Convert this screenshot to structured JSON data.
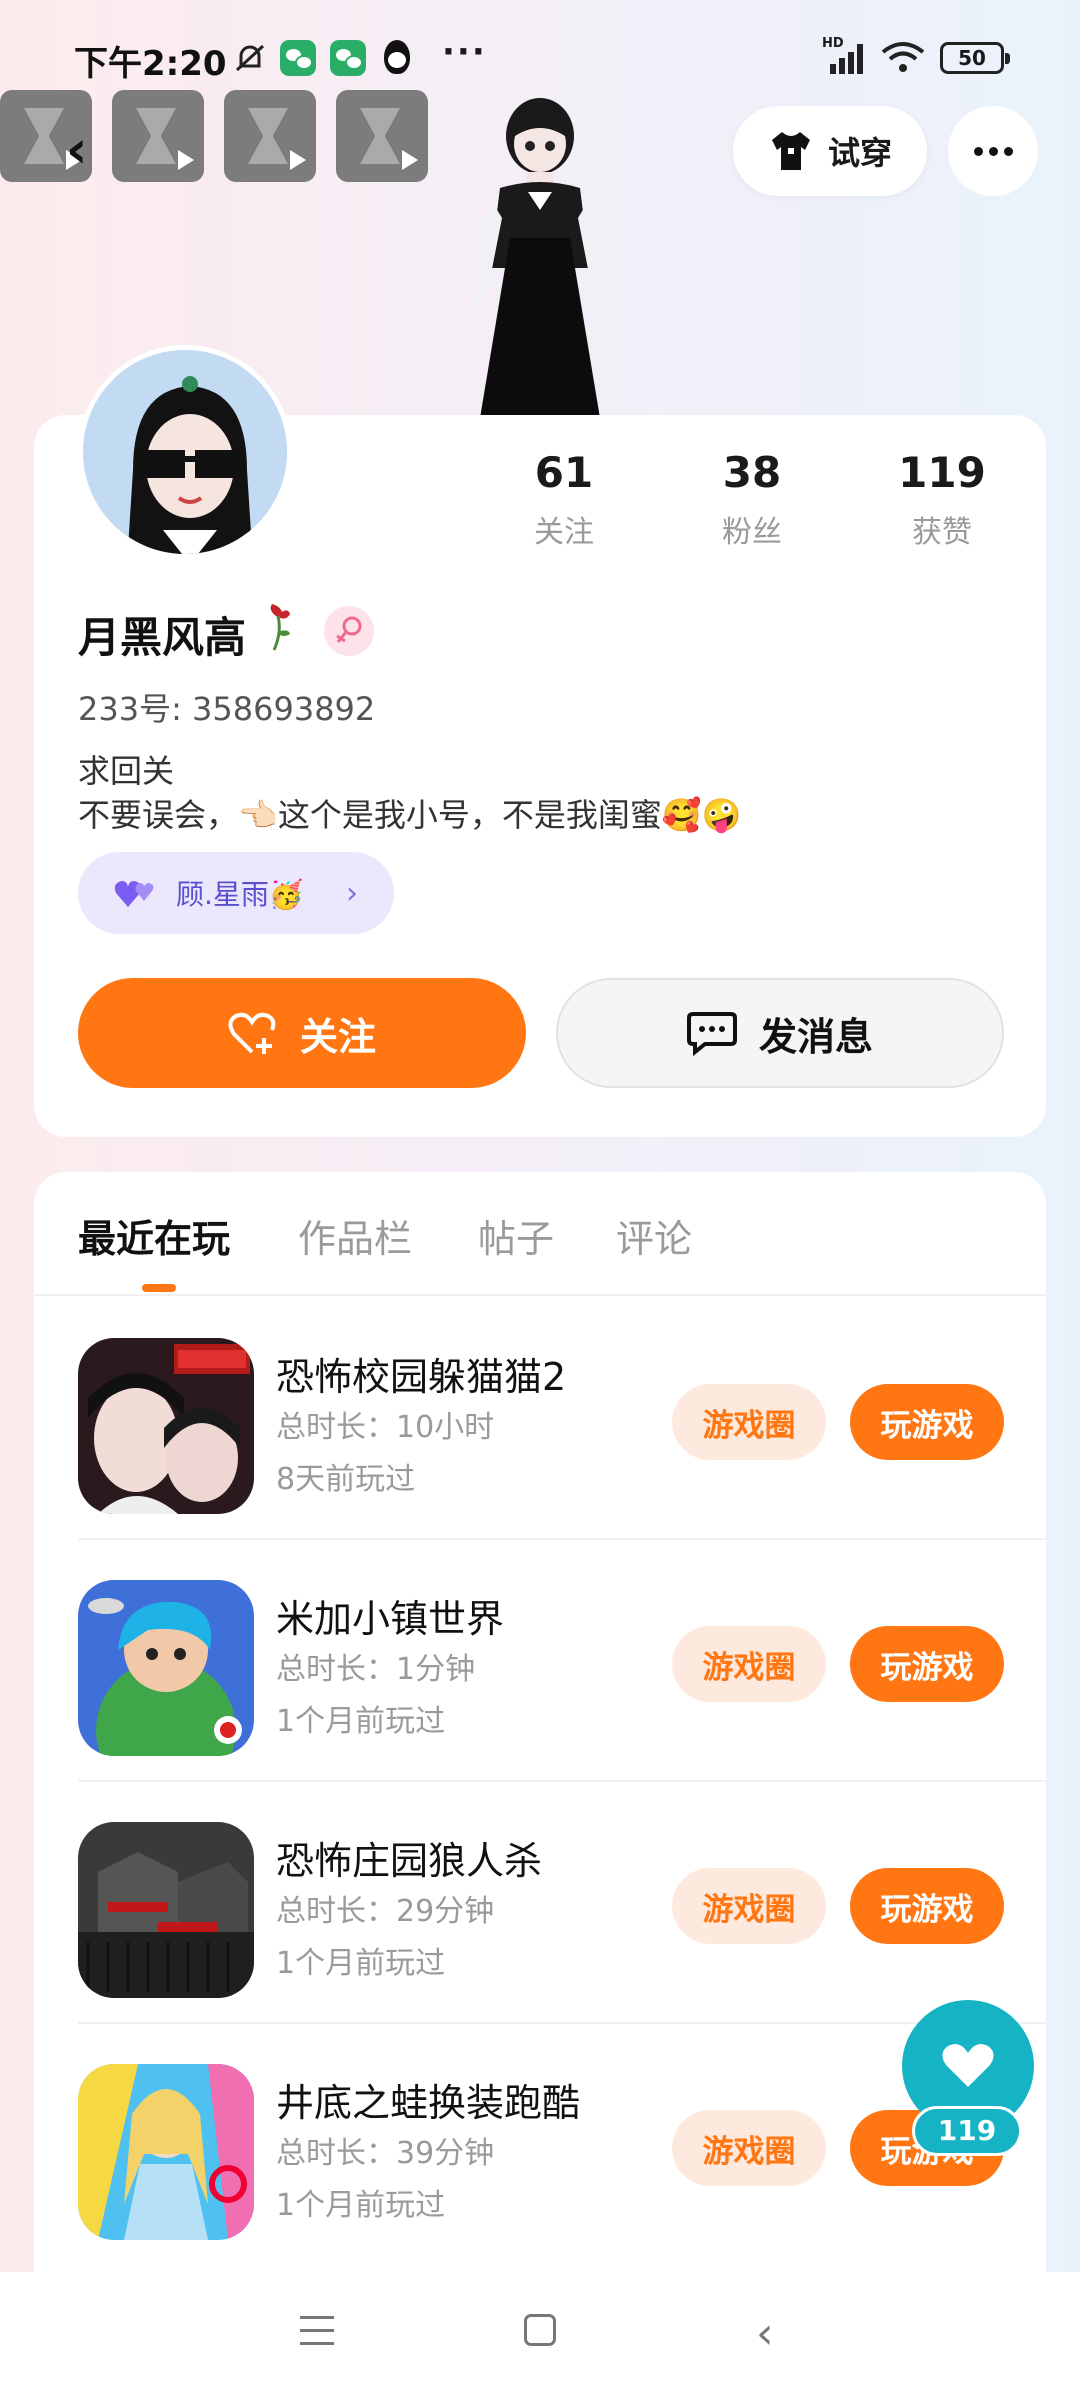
{
  "status_bar": {
    "time": "下午2:20",
    "battery": "50",
    "network": "HD"
  },
  "header": {
    "tryon_label": "试穿"
  },
  "profile": {
    "stats": [
      {
        "value": "61",
        "label": "关注"
      },
      {
        "value": "38",
        "label": "粉丝"
      },
      {
        "value": "119",
        "label": "获赞"
      }
    ],
    "username": "月黑风高",
    "uid": "233号: 358693892",
    "bio_line1": "求回关",
    "bio_line2": "不要误会，👈🏻这个是我小号，不是我闺蜜🥰🤪",
    "friend_tag": "顾.星雨🥳",
    "follow_label": "关注",
    "message_label": "发消息"
  },
  "tabs": [
    "最近在玩",
    "作品栏",
    "帖子",
    "评论"
  ],
  "games": [
    {
      "name": "恐怖校园躲猫猫2",
      "duration": "总时长：10小时",
      "last_played": "8天前玩过",
      "circle_label": "游戏圈",
      "play_label": "玩游戏"
    },
    {
      "name": "米加小镇世界",
      "duration": "总时长：1分钟",
      "last_played": "1个月前玩过",
      "circle_label": "游戏圈",
      "play_label": "玩游戏"
    },
    {
      "name": "恐怖庄园狼人杀",
      "duration": "总时长：29分钟",
      "last_played": "1个月前玩过",
      "circle_label": "游戏圈",
      "play_label": "玩游戏"
    },
    {
      "name": "井底之蛙换装跑酷",
      "duration": "总时长：39分钟",
      "last_played": "1个月前玩过",
      "circle_label": "游戏圈",
      "play_label": "玩游戏"
    }
  ],
  "floating_like": {
    "count": "119"
  },
  "colors": {
    "accent": "#ff7613",
    "like": "#16b3c4",
    "tag_bg": "#ebe8fd"
  }
}
